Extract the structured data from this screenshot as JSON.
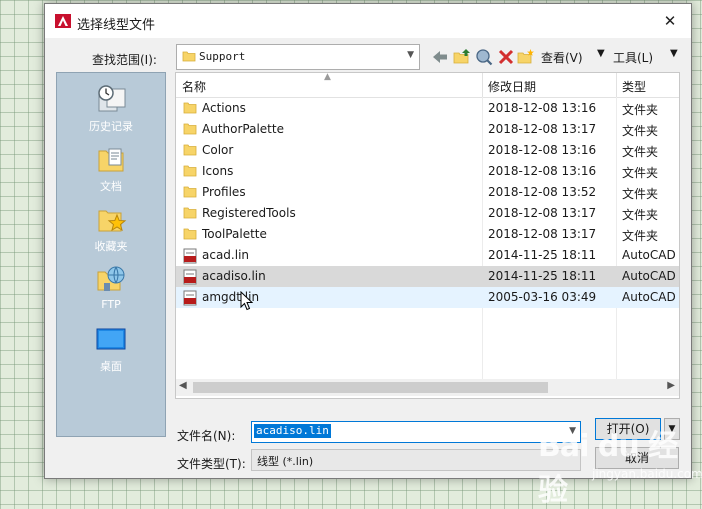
{
  "dialog": {
    "title": "选择线型文件",
    "close_glyph": "✕"
  },
  "look_in": {
    "label": "查找范围(I):",
    "value": "Support"
  },
  "toolbar": {
    "views_label": "查看(V)",
    "tools_label": "工具(L)"
  },
  "places": [
    {
      "label": "历史记录",
      "icon": "history-icon"
    },
    {
      "label": "文档",
      "icon": "documents-icon"
    },
    {
      "label": "收藏夹",
      "icon": "favorites-icon"
    },
    {
      "label": "FTP",
      "icon": "ftp-icon"
    },
    {
      "label": "桌面",
      "icon": "desktop-icon"
    }
  ],
  "file_list": {
    "columns": {
      "name": "名称",
      "date": "修改日期",
      "type": "类型"
    },
    "rows": [
      {
        "name": "Actions",
        "date": "2018-12-08 13:16",
        "type": "文件夹",
        "kind": "folder"
      },
      {
        "name": "AuthorPalette",
        "date": "2018-12-08 13:17",
        "type": "文件夹",
        "kind": "folder"
      },
      {
        "name": "Color",
        "date": "2018-12-08 13:16",
        "type": "文件夹",
        "kind": "folder"
      },
      {
        "name": "Icons",
        "date": "2018-12-08 13:16",
        "type": "文件夹",
        "kind": "folder"
      },
      {
        "name": "Profiles",
        "date": "2018-12-08 13:52",
        "type": "文件夹",
        "kind": "folder"
      },
      {
        "name": "RegisteredTools",
        "date": "2018-12-08 13:17",
        "type": "文件夹",
        "kind": "folder"
      },
      {
        "name": "ToolPalette",
        "date": "2018-12-08 13:17",
        "type": "文件夹",
        "kind": "folder"
      },
      {
        "name": "acad.lin",
        "date": "2014-11-25 18:11",
        "type": "AutoCAD",
        "kind": "lin"
      },
      {
        "name": "acadiso.lin",
        "date": "2014-11-25 18:11",
        "type": "AutoCAD",
        "kind": "lin",
        "state": "selected"
      },
      {
        "name": "amgdt.lin",
        "date": "2005-03-16 03:49",
        "type": "AutoCAD",
        "kind": "lin",
        "state": "hover"
      }
    ]
  },
  "file_name": {
    "label": "文件名(N):",
    "value": "acadiso.lin"
  },
  "file_type": {
    "label": "文件类型(T):",
    "value": "线型 (*.lin)"
  },
  "buttons": {
    "open": "打开(O)",
    "cancel": "取消"
  },
  "watermark": {
    "text": "Bai du 经验",
    "url": "jingyan.baidu.com"
  },
  "colors": {
    "accent": "#0078d7",
    "places_bg": "#b8cad8",
    "folder": "#f7d468",
    "selected_row": "#d9d9d9",
    "hover_row": "#e5f3ff"
  }
}
